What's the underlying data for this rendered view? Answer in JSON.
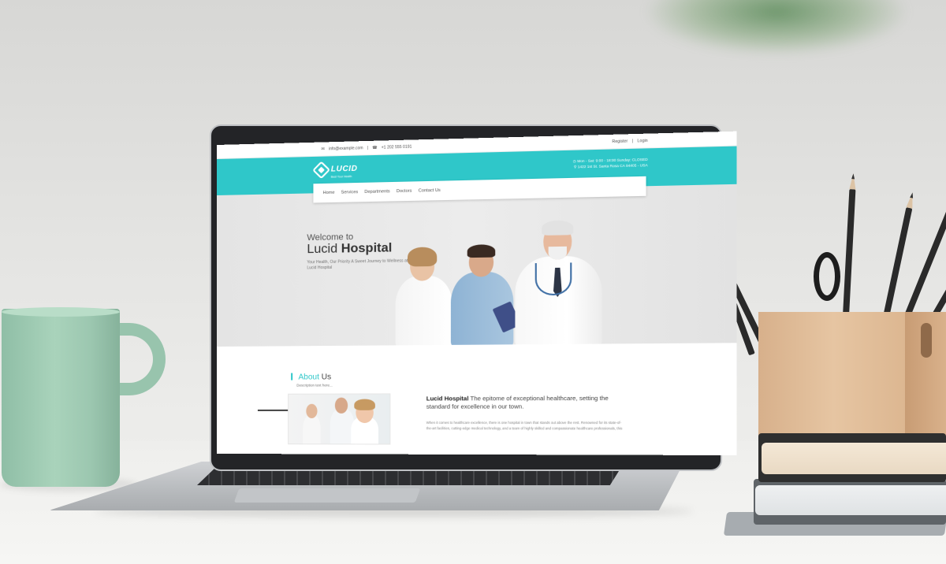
{
  "site": {
    "topbar": {
      "email": "info@example.com",
      "phone": "+1 202 555 0191",
      "register": "Register",
      "separator": "|",
      "login": "Login"
    },
    "header": {
      "logo_name": "LUCID",
      "logo_tagline": "Best Your Health",
      "hours": "Mon - Sat: 9:00 - 18:00 Sunday: CLOSED",
      "address": "1422 1st St. Santa Rosa CA 94405 - USA"
    },
    "nav": [
      "Home",
      "Services",
      "Departments",
      "Doctors",
      "Contact Us"
    ],
    "hero": {
      "welcome": "Welcome to",
      "title_light": "Lucid",
      "title_bold": "Hospital",
      "subtitle": "Your Health, Our Priority A Sweet Journey to Wellness at Lucid Hospital"
    },
    "about": {
      "title_accent": "About",
      "title_rest": "Us",
      "description": "Description text here...",
      "heading_bold": "Lucid Hospital",
      "heading_rest": "The epitome of exceptional healthcare, setting the standard for excellence in our town.",
      "body": "When it comes to healthcare excellence, there is one hospital in town that stands out above the rest. Renowned for its state-of-the-art facilities, cutting-edge medical technology, and a team of highly skilled and compassionate healthcare professionals, this"
    }
  },
  "colors": {
    "brand": "#2fc7c9",
    "mug": "#a9d3bb",
    "wood": "#e6c5a2"
  },
  "icons": {
    "email": "envelope-icon",
    "phone": "phone-icon",
    "clock": "clock-icon",
    "location": "map-pin-icon"
  }
}
